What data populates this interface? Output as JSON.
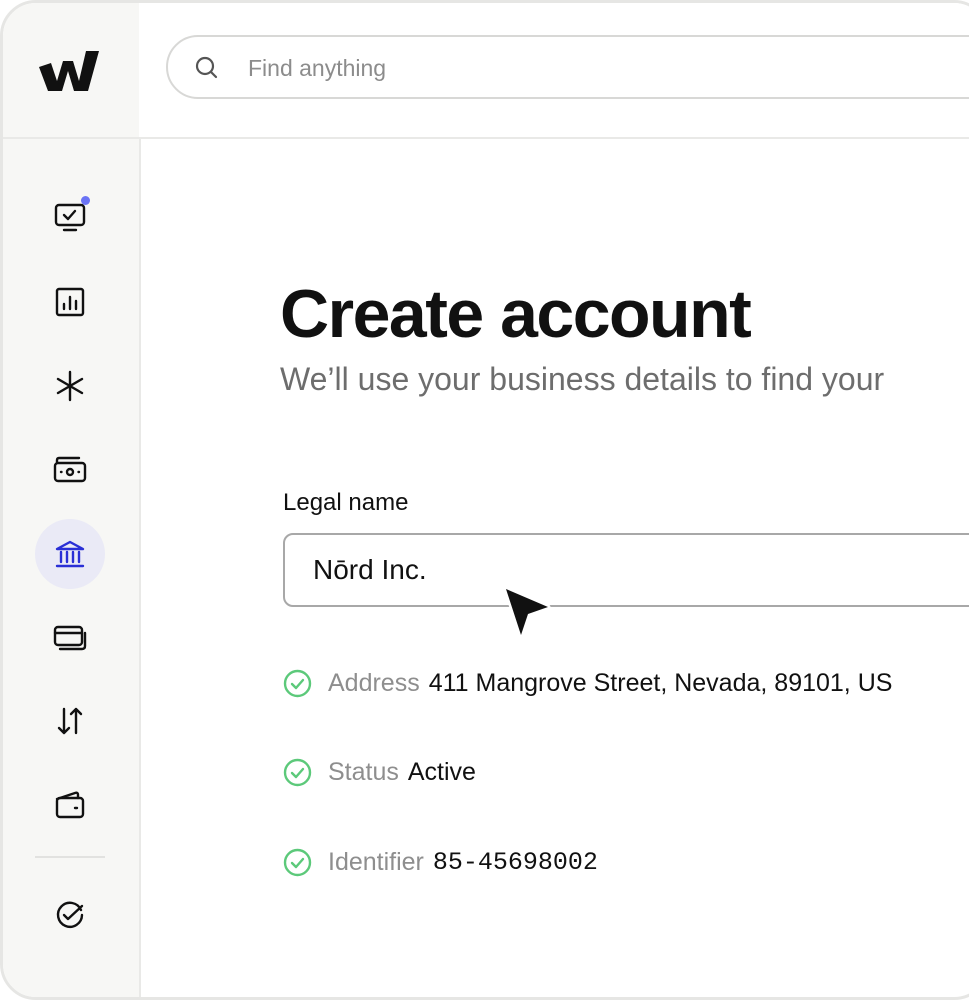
{
  "search": {
    "placeholder": "Find anything"
  },
  "sidebar": {
    "items": [
      {
        "icon": "monitor-check-icon",
        "notification": true
      },
      {
        "icon": "bar-chart-icon"
      },
      {
        "icon": "asterisk-icon"
      },
      {
        "icon": "cash-icon"
      },
      {
        "icon": "bank-icon",
        "active": true
      },
      {
        "icon": "cards-icon"
      },
      {
        "icon": "transfer-arrows-icon"
      },
      {
        "icon": "wallet-icon"
      },
      {
        "icon": "check-circle-icon"
      }
    ]
  },
  "page": {
    "title": "Create account",
    "subtitle": "We’ll use your business details to find your"
  },
  "form": {
    "legal_name_label": "Legal name",
    "legal_name_value": "Nōrd Inc."
  },
  "details": [
    {
      "key": "Address",
      "value": "411 Mangrove Street, Nevada, 89101, US"
    },
    {
      "key": "Status",
      "value": "Active"
    },
    {
      "key": "Identifier",
      "value": "85-45698002"
    }
  ],
  "colors": {
    "accent": "#2a2fd6",
    "notification": "#6a73f5",
    "success": "#5cc97a",
    "active_bg": "#eaeaf6"
  }
}
